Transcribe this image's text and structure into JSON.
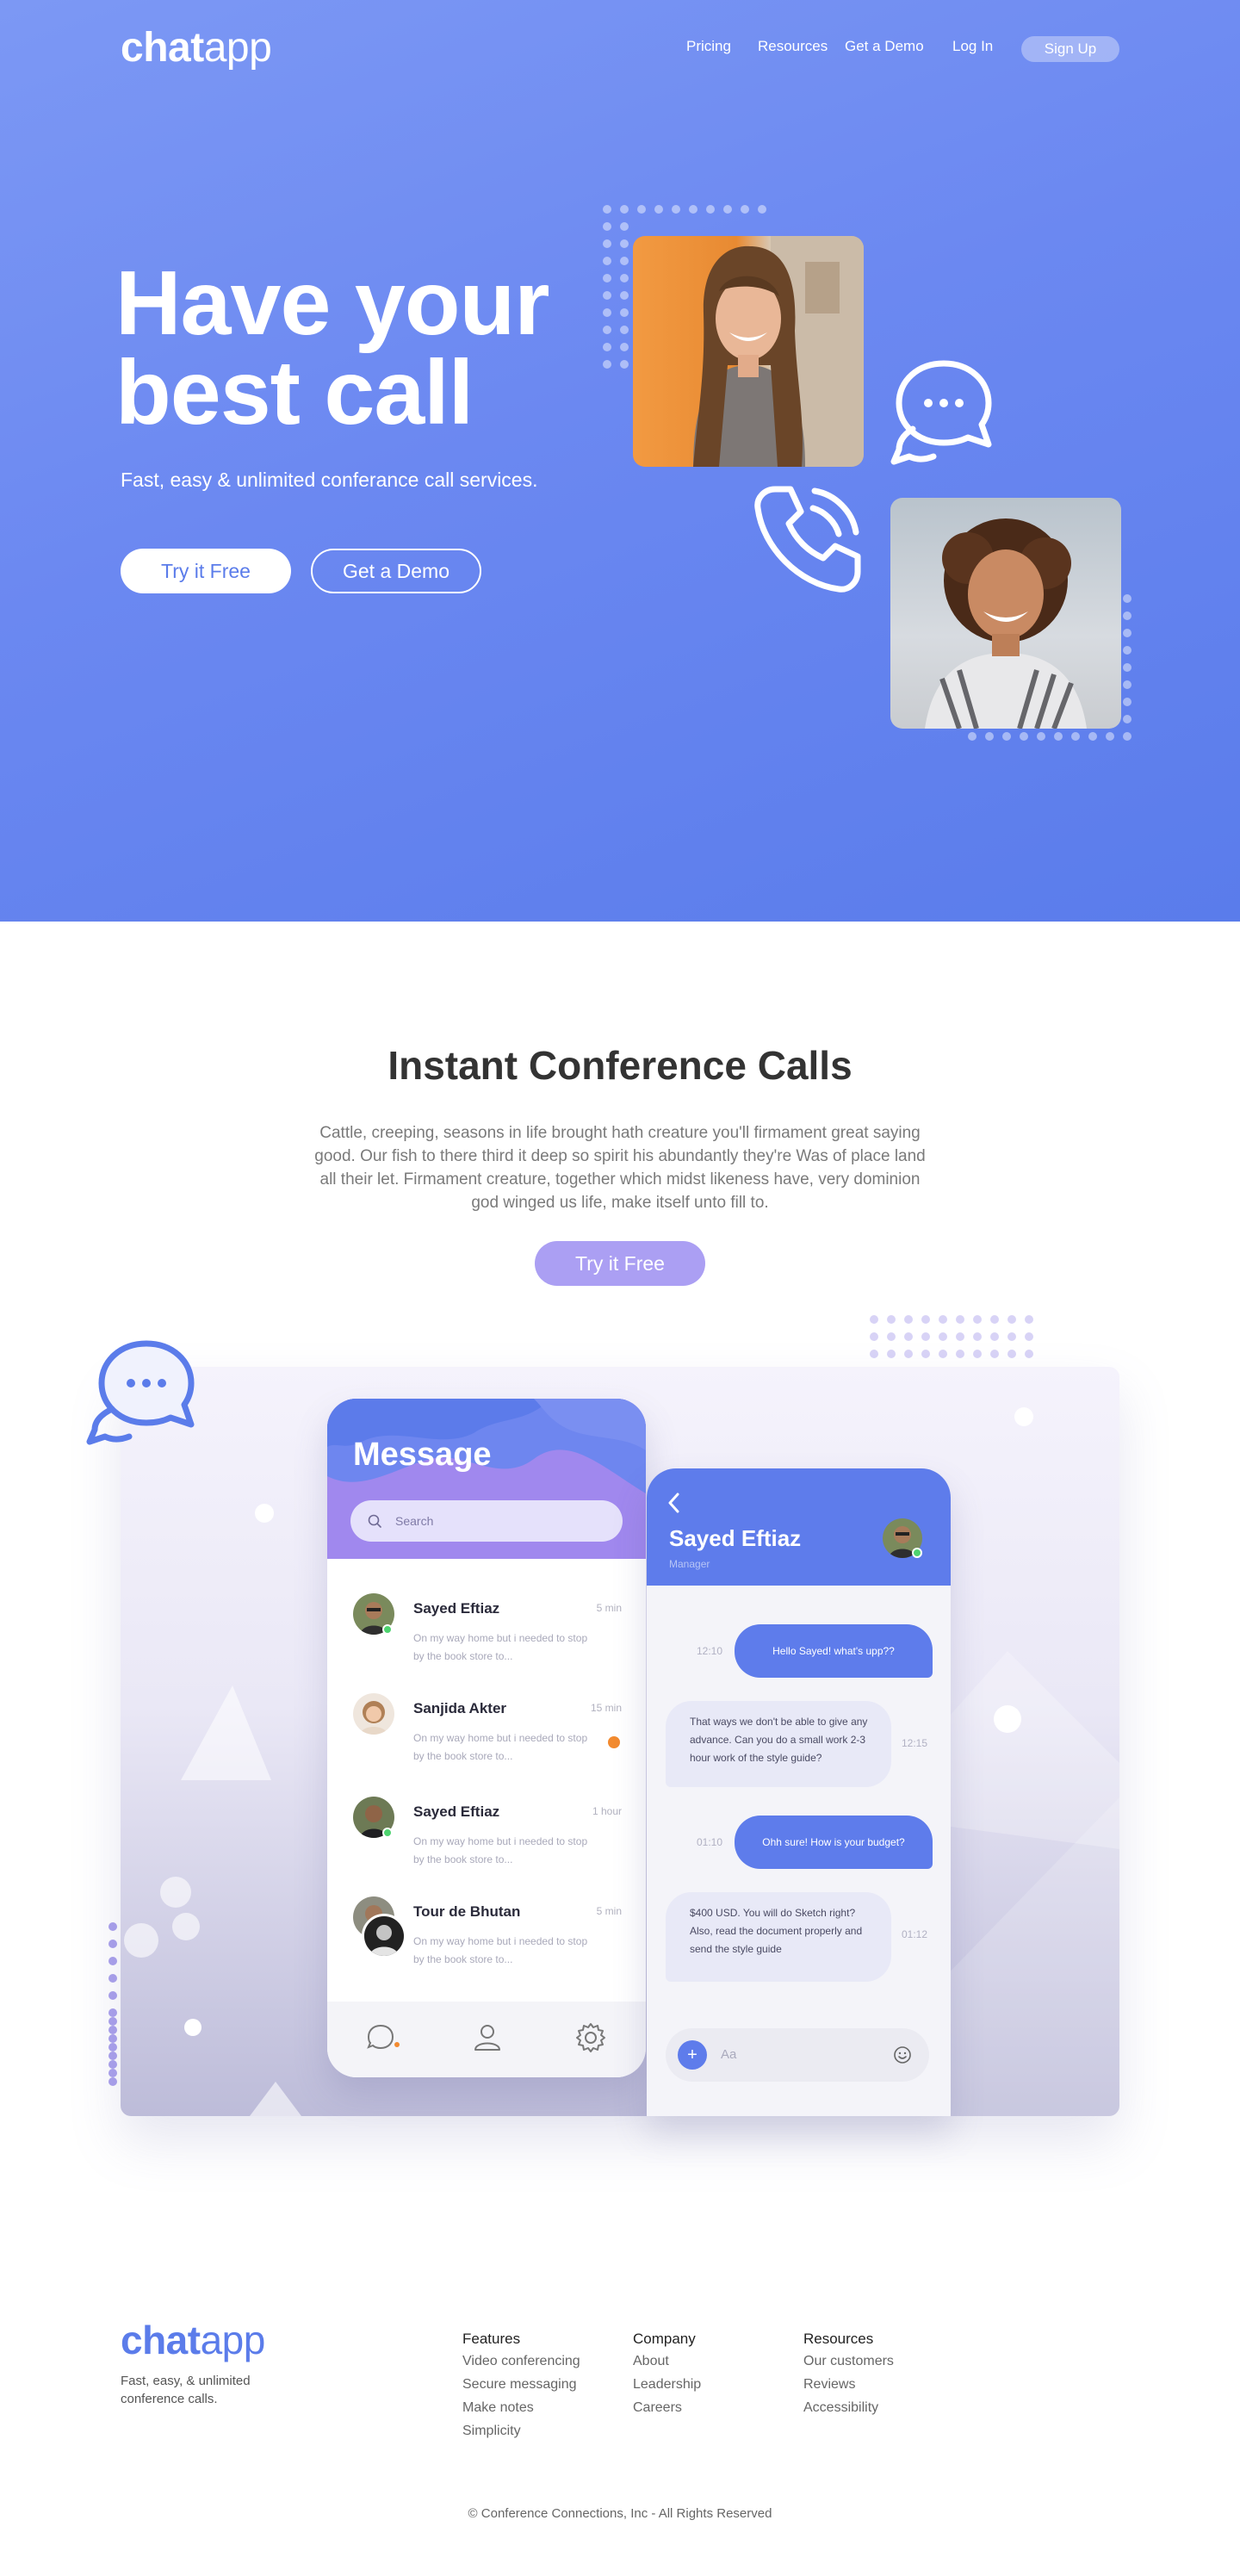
{
  "nav": {
    "logo_bold": "chat",
    "logo_light": "app",
    "links": [
      {
        "label": "Pricing"
      },
      {
        "label": "Resources"
      },
      {
        "label": "Get a Demo"
      },
      {
        "label": "Log In"
      }
    ],
    "signup_label": "Sign Up"
  },
  "hero": {
    "title_line1": "Have your",
    "title_line2": "best call",
    "subtitle": "Fast, easy & unlimited conferance call services.",
    "primary_cta": "Try it Free",
    "secondary_cta": "Get a Demo",
    "icons": [
      "chat-bubbles-icon",
      "phone-icon"
    ]
  },
  "feature": {
    "title": "Instant Conference Calls",
    "body": "Cattle, creeping, seasons in life brought hath creature you'll firmament great saying good. Our fish to there third it deep so spirit his abundantly they're Was of place land all their let. Firmament creature, together which midst likeness have, very dominion god winged us life, make itself unto fill to.",
    "cta": "Try it Free"
  },
  "messages_screen": {
    "title": "Message",
    "search_placeholder": "Search",
    "contacts": [
      {
        "name": "Sayed Eftiaz",
        "time": "5 min",
        "message": "On my way home but i needed to stop by the book store to...",
        "online": true,
        "unread": false
      },
      {
        "name": "Sanjida Akter",
        "time": "15 min",
        "message": "On my way home but i needed to stop by the book store to...",
        "online": false,
        "unread": true
      },
      {
        "name": "Sayed Eftiaz",
        "time": "1 hour",
        "message": "On my way home but i needed to stop by the book store to...",
        "online": true,
        "unread": false
      },
      {
        "name": "Tour de Bhutan",
        "time": "5 min",
        "message": "On my way home but i needed to stop by the book store to...",
        "online": false,
        "unread": false
      }
    ],
    "tabs": [
      "chat-icon",
      "user-icon",
      "settings-icon"
    ]
  },
  "chat_screen": {
    "contact_name": "Sayed Eftiaz",
    "contact_role": "Manager",
    "messages": [
      {
        "direction": "out",
        "text": "Hello Sayed! what's upp??",
        "time": "12:10"
      },
      {
        "direction": "in",
        "text": "That ways we don't be able to give any advance. Can you do a small work 2-3 hour work of the style guide?",
        "time": "12:15"
      },
      {
        "direction": "out",
        "text": "Ohh sure! How is your budget?",
        "time": "01:10"
      },
      {
        "direction": "in",
        "text": "$400 USD. You will do Sketch right? Also, read the document properly and send the style guide",
        "time": "01:12"
      }
    ],
    "input_placeholder": "Aa"
  },
  "footer": {
    "logo_bold": "chat",
    "logo_light": "app",
    "tagline": "Fast, easy, & unlimited conference calls.",
    "columns": [
      {
        "title": "Features",
        "links": [
          "Video conferencing",
          "Secure messaging",
          "Make notes",
          "Simplicity"
        ]
      },
      {
        "title": "Company",
        "links": [
          "About",
          "Leadership",
          "Careers"
        ]
      },
      {
        "title": "Resources",
        "links": [
          "Our customers",
          "Reviews",
          "Accessibility"
        ]
      }
    ],
    "copyright": "© Conference Connections, Inc - All Rights Reserved"
  },
  "colors": {
    "hero_gradient_start": "#7c98f4",
    "hero_gradient_end": "#5a7ceb",
    "brand_blue": "#5b7cea",
    "accent_purple": "#ab9ff3",
    "online_green": "#4ed36f",
    "unread_orange": "#f28a2f"
  }
}
